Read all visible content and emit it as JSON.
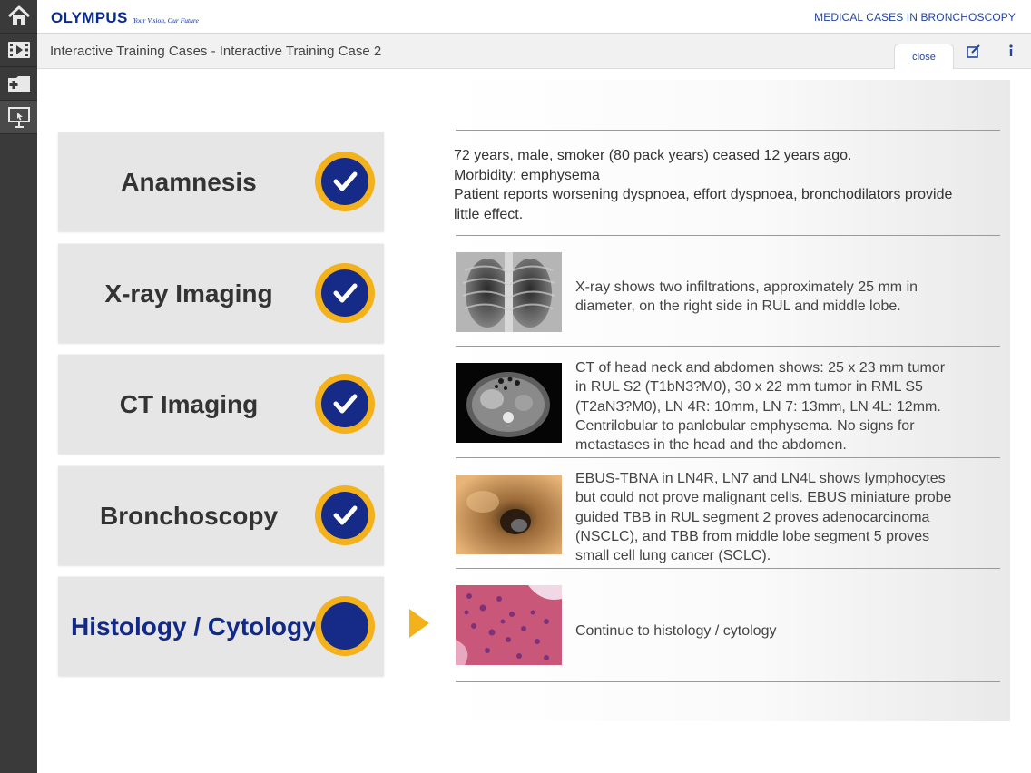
{
  "sidebar": {
    "items": [
      {
        "icon": "home-icon"
      },
      {
        "icon": "film-icon"
      },
      {
        "icon": "add-folder-icon"
      },
      {
        "icon": "presentation-icon"
      }
    ]
  },
  "header": {
    "logo": "OLYMPUS",
    "tagline": "Your Vision, Our Future",
    "app_title": "MEDICAL CASES IN BRONCHOSCOPY"
  },
  "subheader": {
    "breadcrumb": "Interactive Training Cases - Interactive Training Case 2",
    "close_label": "close"
  },
  "steps": [
    {
      "label": "Anamnesis",
      "status": "done"
    },
    {
      "label": "X-ray Imaging",
      "status": "done"
    },
    {
      "label": "CT Imaging",
      "status": "done"
    },
    {
      "label": "Bronchoscopy",
      "status": "done"
    },
    {
      "label": "Histology / Cytology",
      "status": "current"
    }
  ],
  "content": {
    "anamnesis": [
      "72 years, male, smoker (80 pack years) ceased 12 years ago.",
      "Morbidity: emphysema",
      "Patient reports worsening dyspnoea, effort dyspnoea, bronchodilators provide little effect."
    ],
    "rows": [
      {
        "image": "chest-xray-image",
        "text": "X-ray shows two infiltrations, approximately 25 mm in diameter, on the right side in RUL and middle lobe."
      },
      {
        "image": "ct-scan-image",
        "text": "CT of head neck and abdomen shows: 25 x 23 mm tumor in RUL S2 (T1bN3?M0), 30 x 22 mm tumor in RML S5 (T2aN3?M0), LN 4R: 10mm, LN 7: 13mm, LN 4L: 12mm. Centrilobular to panlobular emphysema. No signs for metastases in the head and the abdomen."
      },
      {
        "image": "bronchoscopy-image",
        "text": "EBUS-TBNA in LN4R, LN7 and LN4L shows lymphocytes but could not prove malignant cells. EBUS miniature probe guided TBB in RUL segment 2 proves adenocarcinoma (NSCLC), and TBB from middle lobe segment 5 proves small cell lung cancer (SCLC)."
      },
      {
        "image": "histology-image",
        "text": "Continue to histology / cytology"
      }
    ]
  },
  "colors": {
    "brand_blue": "#0a2c8f",
    "accent_yellow": "#f3b21b",
    "check_blue": "#162a88"
  }
}
